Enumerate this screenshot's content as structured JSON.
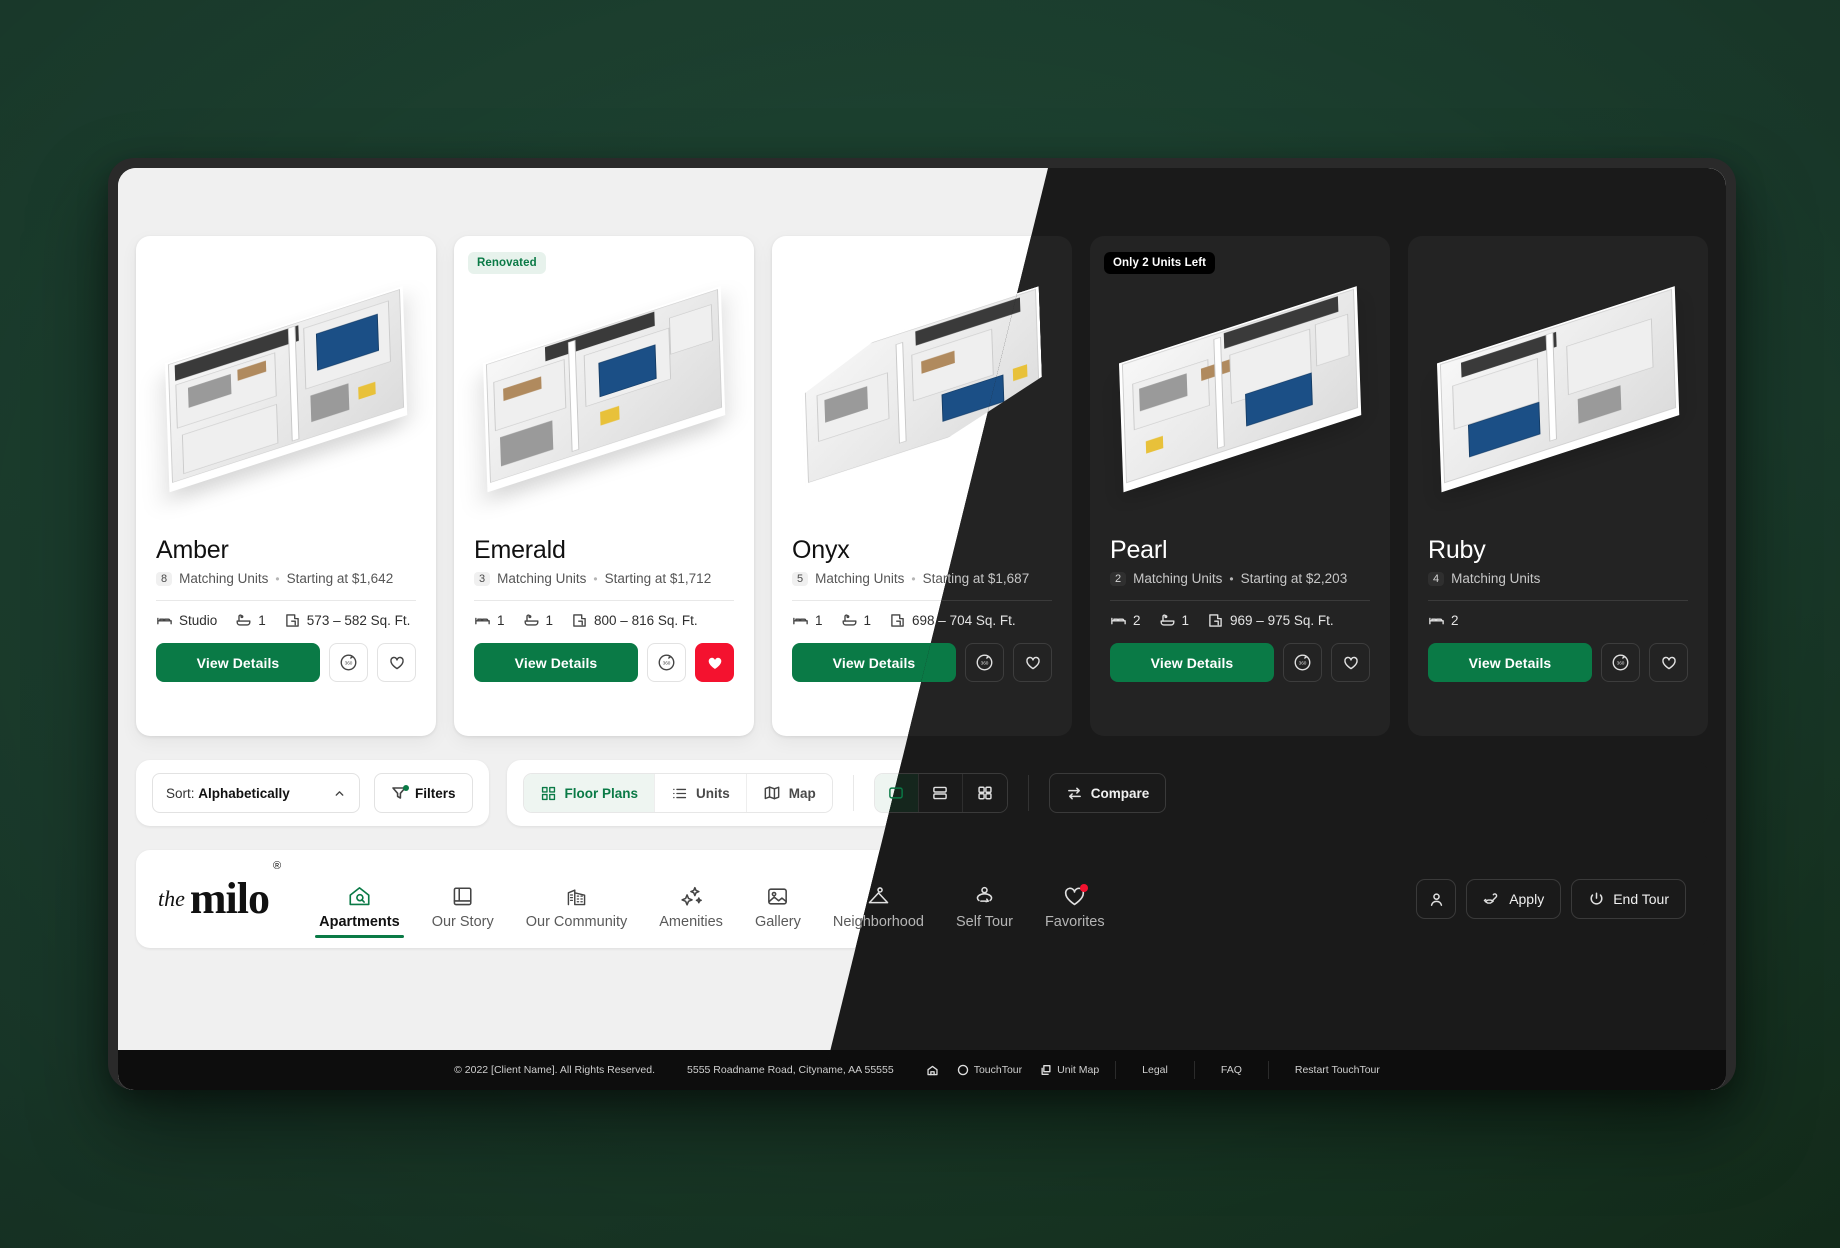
{
  "cards": [
    {
      "name": "Amber",
      "units": "8",
      "units_label": "Matching Units",
      "price": "Starting at $1,642",
      "beds": "Studio",
      "baths": "1",
      "sqft": "573 – 582 Sq. Ft.",
      "cta": "View Details",
      "badge": "",
      "favorited": false
    },
    {
      "name": "Emerald",
      "units": "3",
      "units_label": "Matching Units",
      "price": "Starting at $1,712",
      "beds": "1",
      "baths": "1",
      "sqft": "800 – 816 Sq. Ft.",
      "cta": "View Details",
      "badge": "Renovated",
      "favorited": true
    },
    {
      "name": "Onyx",
      "units": "5",
      "units_label": "Matching Units",
      "price": "Starting at $1,687",
      "beds": "1",
      "baths": "1",
      "sqft": "698 – 704 Sq. Ft.",
      "cta": "View Details",
      "badge": "",
      "favorited": false
    },
    {
      "name": "Pearl",
      "units": "2",
      "units_label": "Matching Units",
      "price": "Starting at $2,203",
      "beds": "2",
      "baths": "1",
      "sqft": "969 – 975 Sq. Ft.",
      "cta": "View Details",
      "badge": "Only 2 Units Left",
      "favorited": false
    },
    {
      "name": "Ruby",
      "units": "4",
      "units_label": "Matching Units",
      "price": "",
      "beds": "2",
      "baths": "",
      "sqft": "",
      "cta": "View Details",
      "badge": "",
      "favorited": false
    }
  ],
  "toolbar": {
    "sort_prefix": "Sort: ",
    "sort_value": "Alphabetically",
    "filters_label": "Filters",
    "view_tabs": [
      {
        "label": "Floor Plans",
        "active": true
      },
      {
        "label": "Units",
        "active": false
      },
      {
        "label": "Map",
        "active": false
      }
    ],
    "layout_modes": [
      {
        "name": "single",
        "active": true
      },
      {
        "name": "rows",
        "active": false
      },
      {
        "name": "grid",
        "active": false
      }
    ],
    "compare_label": "Compare"
  },
  "nav": {
    "logo_the": "the",
    "logo_name": "milo",
    "logo_reg": "®",
    "items": [
      {
        "label": "Apartments",
        "icon": "house-search-icon",
        "active": true
      },
      {
        "label": "Our Story",
        "icon": "book-icon",
        "active": false
      },
      {
        "label": "Our Community",
        "icon": "buildings-icon",
        "active": false
      },
      {
        "label": "Amenities",
        "icon": "sparkles-icon",
        "active": false
      },
      {
        "label": "Gallery",
        "icon": "image-icon",
        "active": false
      },
      {
        "label": "Neighborhood",
        "icon": "map-pin-icon",
        "active": false
      },
      {
        "label": "Self Tour",
        "icon": "person-walk-icon",
        "active": false
      },
      {
        "label": "Favorites",
        "icon": "heart-icon",
        "active": false,
        "badge": true
      }
    ],
    "account_icon": "user-icon",
    "apply_label": "Apply",
    "end_tour_label": "End Tour"
  },
  "footer": {
    "copyright": "© 2022 [Client Name]. All Rights Reserved.",
    "address": "5555 Roadname Road, Cityname, AA 55555",
    "touchtour_label": "TouchTour",
    "unitmap_label": "Unit Map",
    "links": [
      "Legal",
      "FAQ",
      "Restart TouchTour"
    ]
  },
  "colors": {
    "brand_green": "#0a7a46",
    "favorite_red": "#f4122f",
    "dark_bg": "#1a1a1a",
    "backdrop": "#1f4434"
  }
}
